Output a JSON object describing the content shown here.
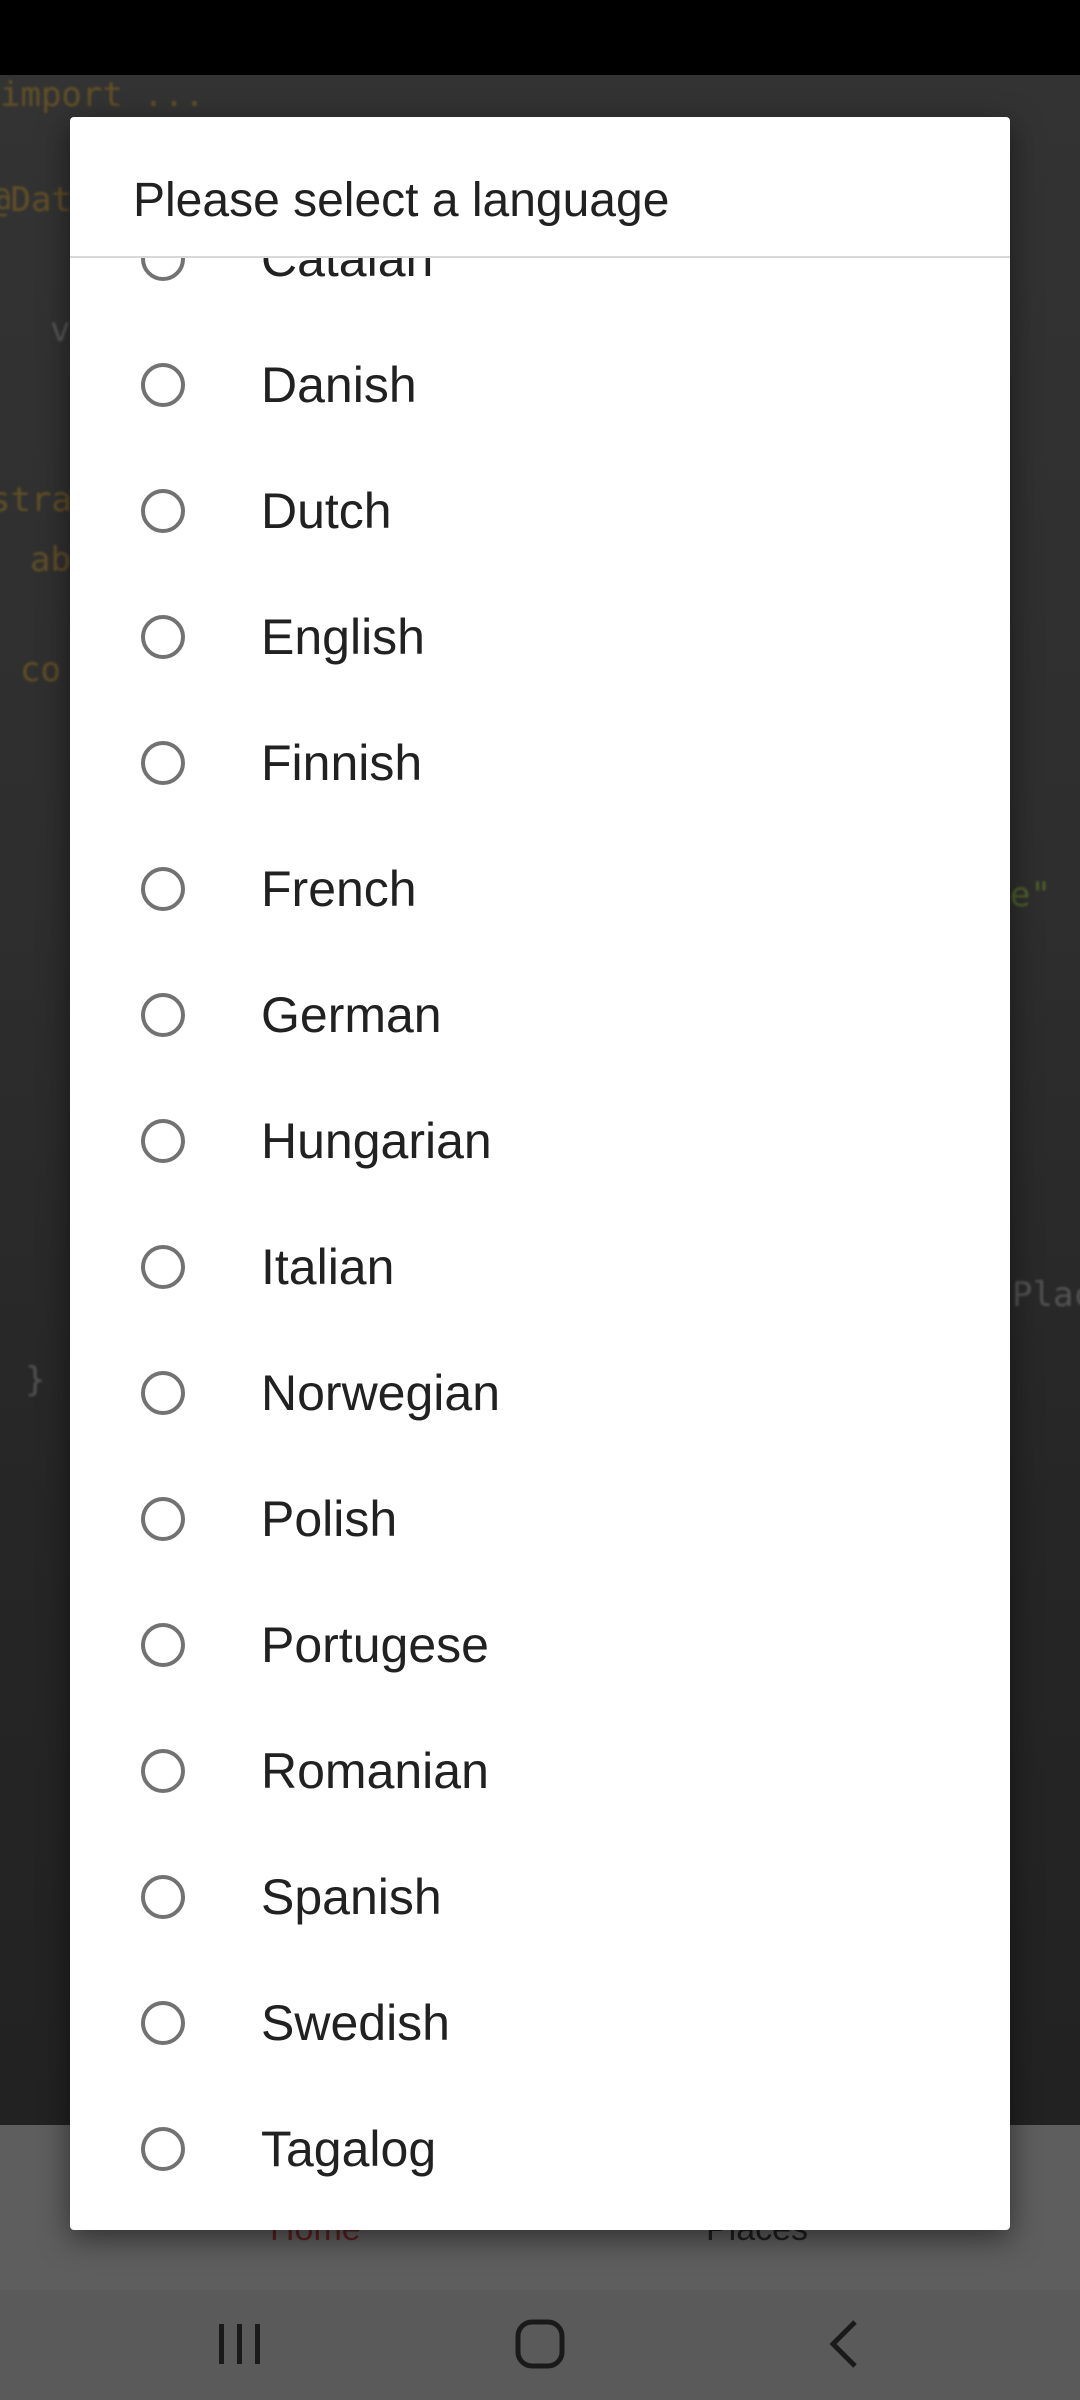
{
  "dialog": {
    "title": "Please select a language",
    "languages": [
      "Catalan",
      "Danish",
      "Dutch",
      "English",
      "Finnish",
      "French",
      "German",
      "Hungarian",
      "Italian",
      "Norwegian",
      "Polish",
      "Portugese",
      "Romanian",
      "Spanish",
      "Swedish",
      "Tagalog"
    ]
  },
  "bottom_nav": {
    "home_label": "Home",
    "places_label": "Places"
  },
  "system_nav": {
    "recent_icon": "recent-apps-icon",
    "home_icon": "home-icon",
    "back_icon": "back-icon"
  }
}
